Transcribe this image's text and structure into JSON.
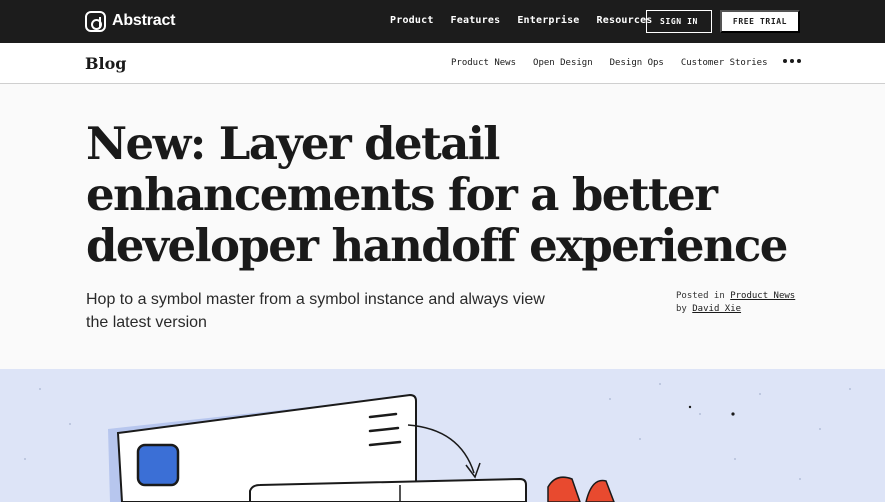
{
  "topnav": {
    "logo_text": "Abstract",
    "links": [
      "Product",
      "Features",
      "Enterprise",
      "Resources"
    ],
    "sign_in": "SIGN IN",
    "free_trial": "FREE TRIAL"
  },
  "subnav": {
    "title": "Blog",
    "links": [
      "Product News",
      "Open Design",
      "Design Ops",
      "Customer Stories"
    ]
  },
  "article": {
    "headline_lines": [
      "New: Layer detail",
      "enhancements for a better",
      "developer handoff experience"
    ],
    "subhead": "Hop to a symbol master from a symbol instance and always view the latest version",
    "posted_in_label": "Posted in",
    "category": "Product News",
    "by_label": "by",
    "author": "David Xie"
  },
  "colors": {
    "topnav_bg": "#1c1c1c",
    "illustration_bg": "#dde4f7",
    "accent_blue": "#3b6fd6",
    "accent_red": "#e84a2f"
  }
}
